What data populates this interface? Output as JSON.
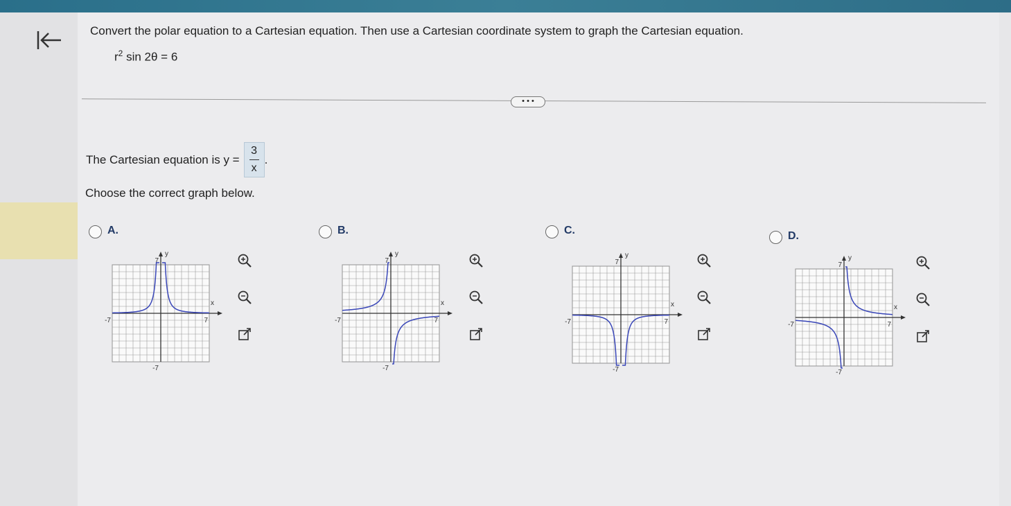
{
  "question": {
    "text": "Convert the polar equation to a Cartesian equation. Then use a Cartesian coordinate system to graph the Cartesian equation.",
    "equation_r": "r",
    "equation_exp": "2",
    "equation_rest": " sin 2θ = 6"
  },
  "more_button": "• • •",
  "answer": {
    "prefix": "The Cartesian equation is y =",
    "numerator": "3",
    "denominator": "x",
    "suffix": "."
  },
  "prompt": "Choose the correct graph below.",
  "options": [
    {
      "label": "A.",
      "variant": "A"
    },
    {
      "label": "B.",
      "variant": "B"
    },
    {
      "label": "C.",
      "variant": "C"
    },
    {
      "label": "D.",
      "variant": "D"
    }
  ],
  "graph_labels": {
    "x": "x",
    "y": "y",
    "max": "7",
    "min": "-7"
  },
  "colors": {
    "curve": "#3a47b8",
    "grid": "#9a9a9a",
    "accent": "#223a66"
  },
  "icons": [
    "back-arrow-icon",
    "zoom-in-icon",
    "zoom-out-icon",
    "open-external-icon"
  ]
}
